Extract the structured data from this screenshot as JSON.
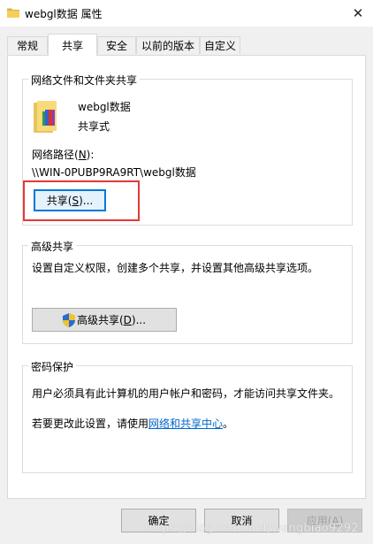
{
  "window": {
    "title": "webgl数据 属性",
    "close_glyph": "✕"
  },
  "tabs": [
    {
      "label": "常规"
    },
    {
      "label": "共享",
      "active": true
    },
    {
      "label": "安全"
    },
    {
      "label": "以前的版本"
    },
    {
      "label": "自定义"
    }
  ],
  "network_sharing": {
    "legend": "网络文件和文件夹共享",
    "folder_name": "webgl数据",
    "share_status": "共享式",
    "path_label_pre": "网络路径(",
    "path_label_key": "N",
    "path_label_post": "):",
    "path_value": "\\\\WIN-0PUBP9RA9RT\\webgl数据",
    "share_button": {
      "pre": "共享(",
      "key": "S",
      "post": ")..."
    }
  },
  "advanced_sharing": {
    "legend": "高级共享",
    "description": "设置自定义权限，创建多个共享，并设置其他高级共享选项。",
    "button": {
      "pre": "高级共享(",
      "key": "D",
      "post": ")..."
    }
  },
  "password_protection": {
    "legend": "密码保护",
    "description": "用户必须具有此计算机的用户帐户和密码，才能访问共享文件夹。",
    "change_pre": "若要更改此设置，请使用",
    "change_link": "网络和共享中心",
    "change_post": "。"
  },
  "footer": {
    "ok": "确定",
    "cancel": "取消",
    "apply_pre": "应用(",
    "apply_key": "A",
    "apply_post": ")"
  },
  "watermark": "https://blog.csdn.net/wangbiao9292",
  "colors": {
    "highlight_box": "#e53935",
    "link": "#0066cc",
    "focus": "#0078d7"
  }
}
